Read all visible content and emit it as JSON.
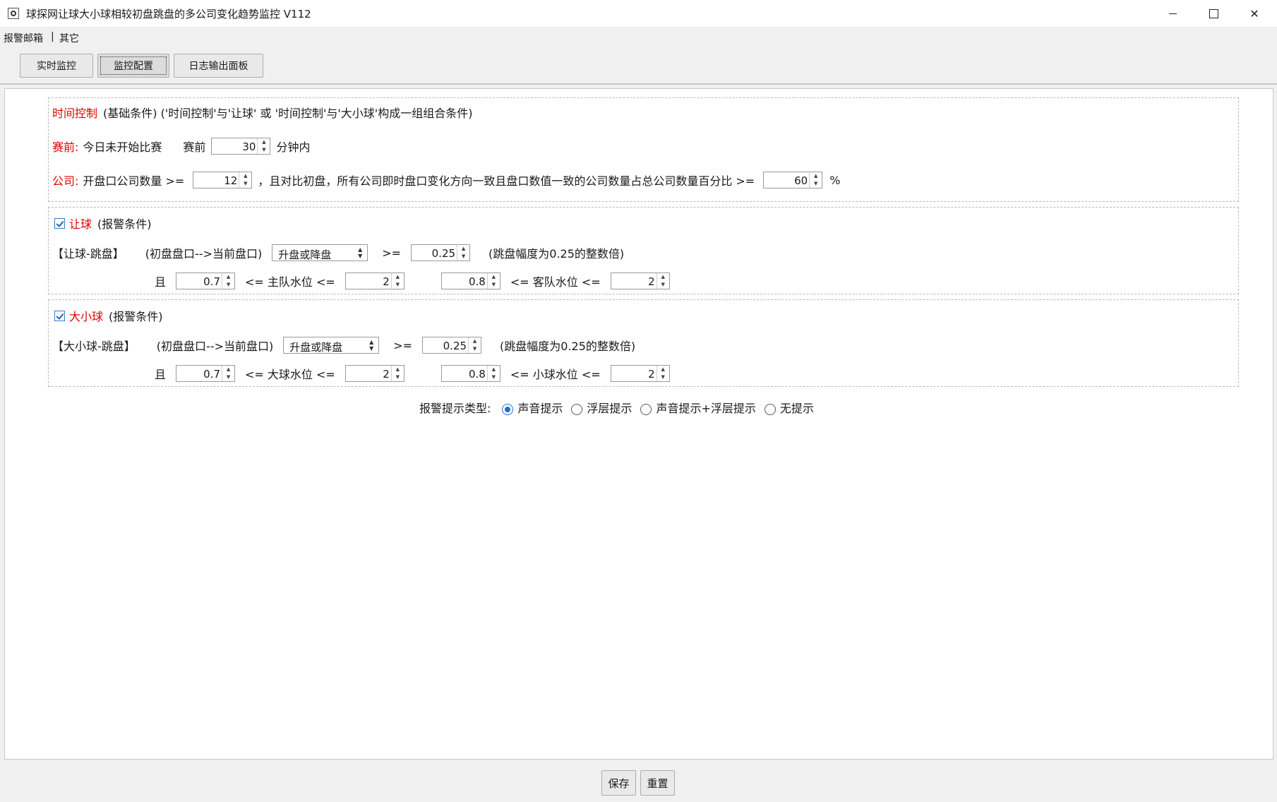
{
  "window": {
    "title": "球探网让球大小球相较初盘跳盘的多公司变化趋势监控 V112"
  },
  "menu": {
    "alarm_mail": "报警邮箱",
    "separator": "|",
    "other": "其它"
  },
  "tabs": {
    "realtime": "实时监控",
    "config": "监控配置",
    "log": "日志输出面板"
  },
  "time_control": {
    "title": "时间控制",
    "desc": "(基础条件) ('时间控制'与'让球' 或 '时间控制'与'大小球'构成一组组合条件)",
    "pre_label": "赛前:",
    "pre_text": "今日未开始比赛",
    "pre_before": "赛前",
    "minutes": "30",
    "minutes_unit": "分钟内",
    "company_label": "公司:",
    "company_text": "开盘口公司数量 >=",
    "company_count": "12",
    "company_text2": "，且对比初盘，所有公司即时盘口变化方向一致且盘口数值一致的公司数量占总公司数量百分比 >=",
    "percent": "60",
    "percent_unit": "%"
  },
  "handicap": {
    "title": "让球",
    "cond": "(报警条件)",
    "checked": true,
    "jump_label": "【让球-跳盘】",
    "flow": "(初盘盘口-->当前盘口)",
    "direction": "升盘或降盘",
    "ge": ">=",
    "step": "0.25",
    "step_note": "(跳盘幅度为0.25的整数倍)",
    "and": "且",
    "home_min": "0.7",
    "home_label": "<= 主队水位 <=",
    "home_max": "2",
    "away_min": "0.8",
    "away_label": "<= 客队水位 <=",
    "away_max": "2"
  },
  "overunder": {
    "title": "大小球",
    "cond": "(报警条件)",
    "checked": true,
    "jump_label": "【大小球-跳盘】",
    "flow": "(初盘盘口-->当前盘口)",
    "direction": "升盘或降盘",
    "ge": ">=",
    "step": "0.25",
    "step_note": "(跳盘幅度为0.25的整数倍)",
    "and": "且",
    "over_min": "0.7",
    "over_label": "<= 大球水位 <=",
    "over_max": "2",
    "under_min": "0.8",
    "under_label": "<= 小球水位 <=",
    "under_max": "2"
  },
  "alert": {
    "label": "报警提示类型:",
    "options": [
      "声音提示",
      "浮层提示",
      "声音提示+浮层提示",
      "无提示"
    ],
    "selected": "声音提示"
  },
  "buttons": {
    "save": "保存",
    "reset": "重置"
  },
  "colors": {
    "accent_red": "#e00000",
    "radio_blue": "#1f6fd6"
  }
}
